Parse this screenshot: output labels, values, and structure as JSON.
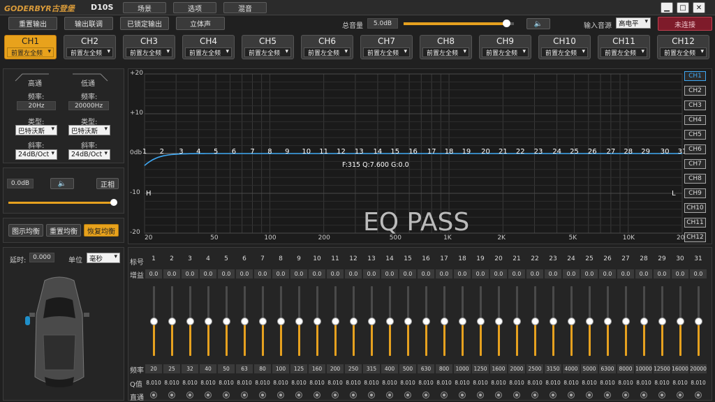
{
  "app": {
    "brand": "GODERBYR古登堡",
    "model": "D10S"
  },
  "menu": [
    "场景",
    "选项",
    "混音"
  ],
  "toolbar": {
    "reset": "重置输出",
    "link": "输出联调",
    "lock": "已锁定输出",
    "stereo": "立体声"
  },
  "master": {
    "label": "总音量",
    "value": "5.0dB",
    "level": 0.93
  },
  "input": {
    "label": "输入音源",
    "value": "高电平"
  },
  "status": "未连接",
  "colors": {
    "accent": "#e8a21c",
    "curve": "#3fa9f5",
    "status": "#8a1c2a"
  },
  "channels": [
    {
      "name": "CH1",
      "sub": "前置左全频"
    },
    {
      "name": "CH2",
      "sub": "前置左全频"
    },
    {
      "name": "CH3",
      "sub": "前置左全频"
    },
    {
      "name": "CH4",
      "sub": "前置左全频"
    },
    {
      "name": "CH5",
      "sub": "前置左全频"
    },
    {
      "name": "CH6",
      "sub": "前置左全频"
    },
    {
      "name": "CH7",
      "sub": "前置左全频"
    },
    {
      "name": "CH8",
      "sub": "前置左全频"
    },
    {
      "name": "CH9",
      "sub": "前置左全频"
    },
    {
      "name": "CH10",
      "sub": "前置左全频"
    },
    {
      "name": "CH11",
      "sub": "前置左全频"
    },
    {
      "name": "CH12",
      "sub": "前置左全频"
    }
  ],
  "filter": {
    "hp": {
      "title": "高通",
      "freq_label": "频率:",
      "freq": "20Hz",
      "type_label": "类型:",
      "type": "巴特沃斯",
      "slope_label": "斜率:",
      "slope": "24dB/Oct"
    },
    "lp": {
      "title": "低通",
      "freq_label": "频率:",
      "freq": "20000Hz",
      "type_label": "类型:",
      "type": "巴特沃斯",
      "slope_label": "斜率:",
      "slope": "24dB/Oct"
    }
  },
  "gain": {
    "value": "0.0dB",
    "phase": "正相",
    "level": 0.97
  },
  "eqbtn": {
    "graphic": "图示均衡",
    "reset": "重置均衡",
    "restore": "恢复均衡"
  },
  "delay": {
    "label": "延时:",
    "value": "0.000",
    "unit_label": "单位",
    "unit": "毫秒"
  },
  "graph": {
    "y_ticks": [
      "+20",
      "+10",
      "0db",
      "-10",
      "-20"
    ],
    "x_ticks": [
      "20",
      "50",
      "100",
      "200",
      "500",
      "1K",
      "2K",
      "5K",
      "10K",
      "20K"
    ],
    "info": "F:315 Q:7.600 G:0.0",
    "watermark": "EQ PASS",
    "hp_marker": "H",
    "lp_marker": "L",
    "markers": [
      "1",
      "2",
      "3",
      "4",
      "5",
      "6",
      "7",
      "8",
      "9",
      "10",
      "11",
      "12",
      "13",
      "14",
      "15",
      "16",
      "17",
      "18",
      "19",
      "20",
      "21",
      "22",
      "23",
      "24",
      "25",
      "26",
      "27",
      "28",
      "29",
      "30",
      "31"
    ]
  },
  "chsel": [
    "CH1",
    "CH2",
    "CH3",
    "CH4",
    "CH5",
    "CH6",
    "CH7",
    "CH8",
    "CH9",
    "CH10",
    "CH11",
    "CH12"
  ],
  "eq": {
    "labels": {
      "band": "标号",
      "gain": "增益",
      "freq": "频率",
      "q": "Q值",
      "pass": "直通"
    },
    "bands": [
      {
        "n": "1",
        "g": "0.0",
        "f": "20",
        "q": "8.010"
      },
      {
        "n": "2",
        "g": "0.0",
        "f": "25",
        "q": "8.010"
      },
      {
        "n": "3",
        "g": "0.0",
        "f": "32",
        "q": "8.010"
      },
      {
        "n": "4",
        "g": "0.0",
        "f": "40",
        "q": "8.010"
      },
      {
        "n": "5",
        "g": "0.0",
        "f": "50",
        "q": "8.010"
      },
      {
        "n": "6",
        "g": "0.0",
        "f": "63",
        "q": "8.010"
      },
      {
        "n": "7",
        "g": "0.0",
        "f": "80",
        "q": "8.010"
      },
      {
        "n": "8",
        "g": "0.0",
        "f": "100",
        "q": "8.010"
      },
      {
        "n": "9",
        "g": "0.0",
        "f": "125",
        "q": "8.010"
      },
      {
        "n": "10",
        "g": "0.0",
        "f": "160",
        "q": "8.010"
      },
      {
        "n": "11",
        "g": "0.0",
        "f": "200",
        "q": "8.010"
      },
      {
        "n": "12",
        "g": "0.0",
        "f": "250",
        "q": "8.010"
      },
      {
        "n": "13",
        "g": "0.0",
        "f": "315",
        "q": "8.010"
      },
      {
        "n": "14",
        "g": "0.0",
        "f": "400",
        "q": "8.010"
      },
      {
        "n": "15",
        "g": "0.0",
        "f": "500",
        "q": "8.010"
      },
      {
        "n": "16",
        "g": "0.0",
        "f": "630",
        "q": "8.010"
      },
      {
        "n": "17",
        "g": "0.0",
        "f": "800",
        "q": "8.010"
      },
      {
        "n": "18",
        "g": "0.0",
        "f": "1000",
        "q": "8.010"
      },
      {
        "n": "19",
        "g": "0.0",
        "f": "1250",
        "q": "8.010"
      },
      {
        "n": "20",
        "g": "0.0",
        "f": "1600",
        "q": "8.010"
      },
      {
        "n": "21",
        "g": "0.0",
        "f": "2000",
        "q": "8.010"
      },
      {
        "n": "22",
        "g": "0.0",
        "f": "2500",
        "q": "8.010"
      },
      {
        "n": "23",
        "g": "0.0",
        "f": "3150",
        "q": "8.010"
      },
      {
        "n": "24",
        "g": "0.0",
        "f": "4000",
        "q": "8.010"
      },
      {
        "n": "25",
        "g": "0.0",
        "f": "5000",
        "q": "8.010"
      },
      {
        "n": "26",
        "g": "0.0",
        "f": "6300",
        "q": "8.010"
      },
      {
        "n": "27",
        "g": "0.0",
        "f": "8000",
        "q": "8.010"
      },
      {
        "n": "28",
        "g": "0.0",
        "f": "10000",
        "q": "8.010"
      },
      {
        "n": "29",
        "g": "0.0",
        "f": "12500",
        "q": "8.010"
      },
      {
        "n": "30",
        "g": "0.0",
        "f": "16000",
        "q": "8.010"
      },
      {
        "n": "31",
        "g": "0.0",
        "f": "20000",
        "q": "8.010"
      }
    ]
  }
}
